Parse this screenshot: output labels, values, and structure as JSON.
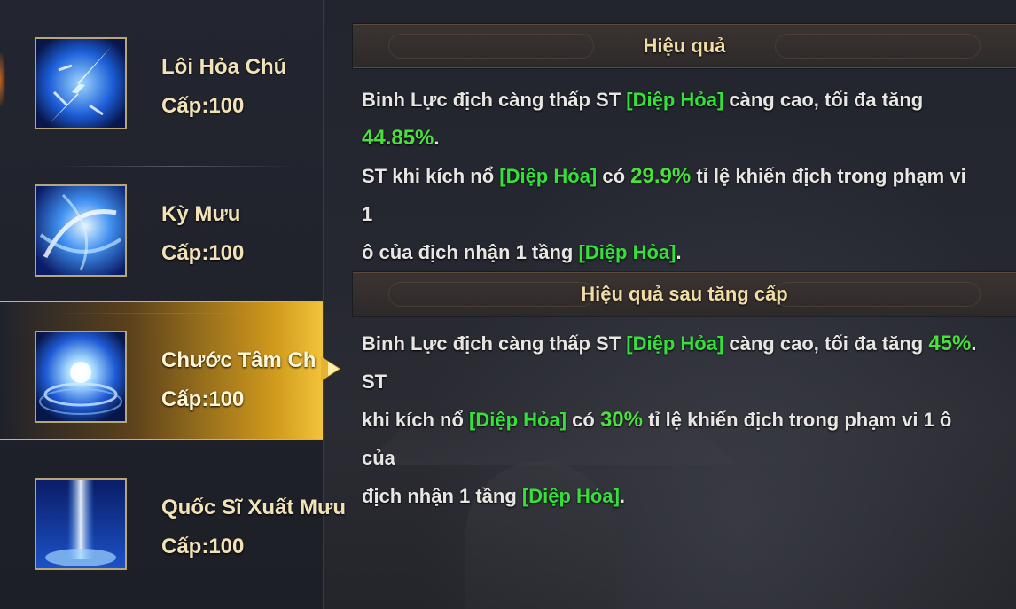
{
  "skills": [
    {
      "name": "Lôi Hỏa Chú",
      "level": "Cấp:100",
      "icon": "lightning-spear-skill-icon",
      "selected": false
    },
    {
      "name": "Kỳ Mưu",
      "level": "Cấp:100",
      "icon": "blue-whirlwind-skill-icon",
      "selected": false
    },
    {
      "name": "Chước Tâm Chi Viêm",
      "level": "Cấp:100",
      "icon": "blue-burst-skill-icon",
      "selected": true
    },
    {
      "name": "Quốc Sĩ Xuất Mưu",
      "level": "Cấp:100",
      "icon": "light-pillar-skill-icon",
      "selected": false
    }
  ],
  "effect": {
    "title": "Hiệu quả",
    "line1_a": "Binh Lực địch càng thấp ST ",
    "tag": "[Diệp Hỏa]",
    "line1_b": " càng cao, tối đa tăng ",
    "max_increase": "44.85%",
    "line1_c": ".",
    "line2_a": " ST khi kích nổ ",
    "line2_b": " có ",
    "chance": "29.9%",
    "line2_c": " tỉ lệ khiến địch trong phạm vi 1",
    "line3_a": "ô của địch nhận 1 tầng  ",
    "line3_b": "."
  },
  "upgrade_effect": {
    "title": "Hiệu quả sau tăng cấp",
    "line1_a": "Binh Lực địch càng thấp ST ",
    "tag": "[Diệp Hỏa]",
    "line1_b": " càng cao, tối đa tăng ",
    "max_increase": "45%",
    "line1_c": ". ST",
    "line2_a": "khi kích nổ ",
    "line2_b": " có ",
    "chance": "30%",
    "line2_c": " tỉ lệ khiến địch trong phạm vi 1 ô của",
    "line3_a": "địch nhận 1 tầng  ",
    "line3_b": "."
  },
  "colors": {
    "highlight_green": "#36e03a",
    "selected_gold": "#e6b230",
    "title_gold": "#f0dca4"
  }
}
